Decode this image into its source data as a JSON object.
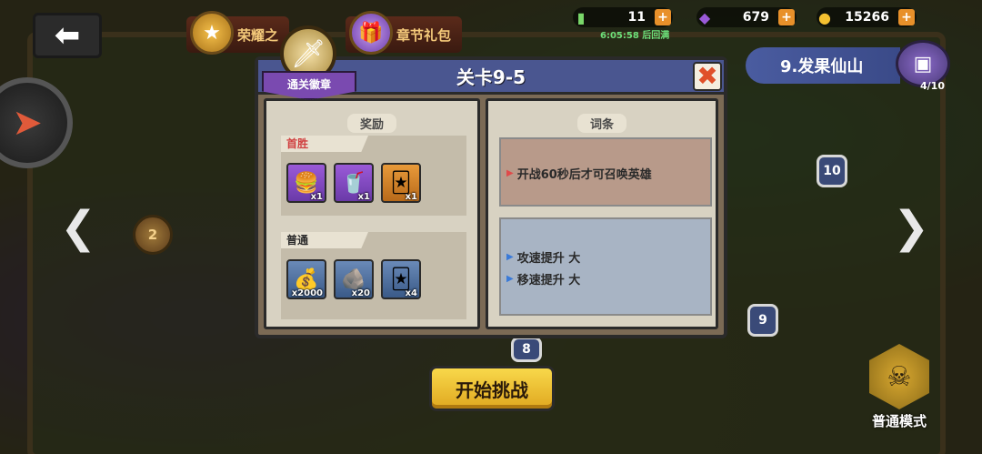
{
  "top_bar": {
    "honor_label": "荣耀之",
    "chapter_gift_label": "章节礼包",
    "resources": [
      {
        "icon": "energy-icon",
        "value": "11"
      },
      {
        "icon": "gem-icon",
        "value": "679"
      },
      {
        "icon": "gold-coin-icon",
        "value": "15266"
      }
    ],
    "timer": "6:05:58 后回满"
  },
  "chapter": {
    "title": "9.发果仙山",
    "progress": "4/10"
  },
  "map_nodes": [
    "2",
    "10",
    "9",
    "8"
  ],
  "dialog": {
    "title": "关卡9-5",
    "badge_label": "通关徽章",
    "rewards_header": "奖励",
    "first_win_label": "首胜",
    "first_win_items": [
      {
        "icon": "burger-icon",
        "qty": "x1",
        "color": "purple"
      },
      {
        "icon": "drink-cup-icon",
        "qty": "x1",
        "color": "purple"
      },
      {
        "icon": "hero-card-icon",
        "qty": "x1",
        "color": "orange"
      }
    ],
    "normal_label": "普通",
    "normal_items": [
      {
        "icon": "gold-pile-icon",
        "qty": "x2000",
        "color": "blue"
      },
      {
        "icon": "ore-icon",
        "qty": "x20",
        "color": "blue"
      },
      {
        "icon": "hero-card-icon",
        "qty": "x4",
        "color": "blue"
      }
    ],
    "conditions_header": "词条",
    "negative_conditions": [
      "开战60秒后才可召唤英雄"
    ],
    "positive_conditions": [
      "攻速提升 大",
      "移速提升 大"
    ]
  },
  "start_button_label": "开始挑战",
  "mode_label": "普通模式",
  "colors": {
    "title_bar": "#4a5690",
    "start_button": "#f0c030",
    "first_win_text": "#d04040"
  }
}
